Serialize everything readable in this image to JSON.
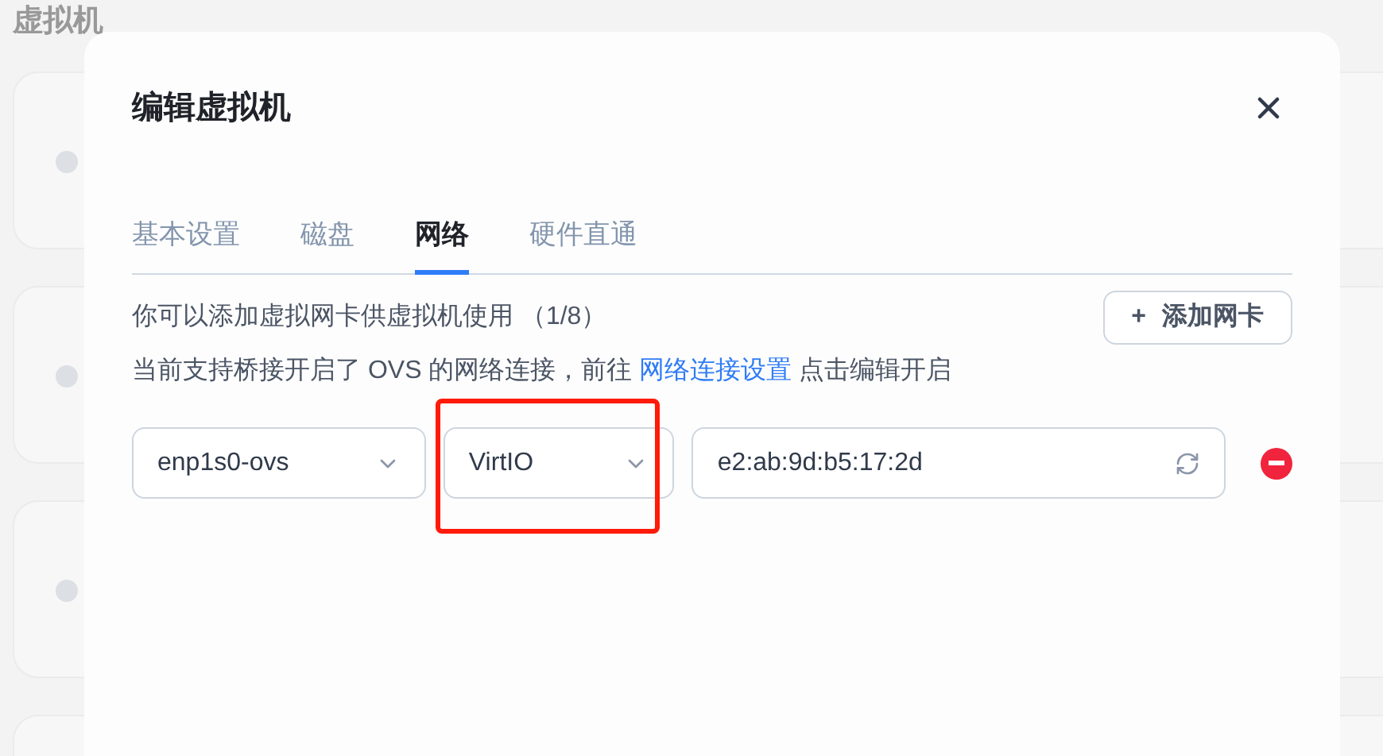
{
  "page": {
    "title": "虚拟机",
    "cards": [
      {
        "kind": "card"
      },
      {
        "kind": "card"
      },
      {
        "kind": "card"
      },
      {
        "kind": "card_edge"
      }
    ]
  },
  "dialog": {
    "title": "编辑虚拟机",
    "tabs": [
      {
        "label": "基本设置",
        "selected": false
      },
      {
        "label": "磁盘",
        "selected": false
      },
      {
        "label": "网络",
        "selected": true
      },
      {
        "label": "硬件直通",
        "selected": false
      }
    ],
    "info": "你可以添加虚拟网卡供虚拟机使用 （1/8）",
    "add_button": {
      "icon": "+",
      "label": "添加网卡"
    },
    "note": {
      "before": "当前支持桥接开启了 OVS 的网络连接，前往",
      "link": "网络连接设置",
      "after": "点击编辑开启"
    },
    "nics": [
      {
        "interface": "enp1s0-ovs",
        "model": "VirtIO",
        "mac": "e2:ab:9d:b5:17:2d",
        "highlighted": true
      }
    ]
  }
}
